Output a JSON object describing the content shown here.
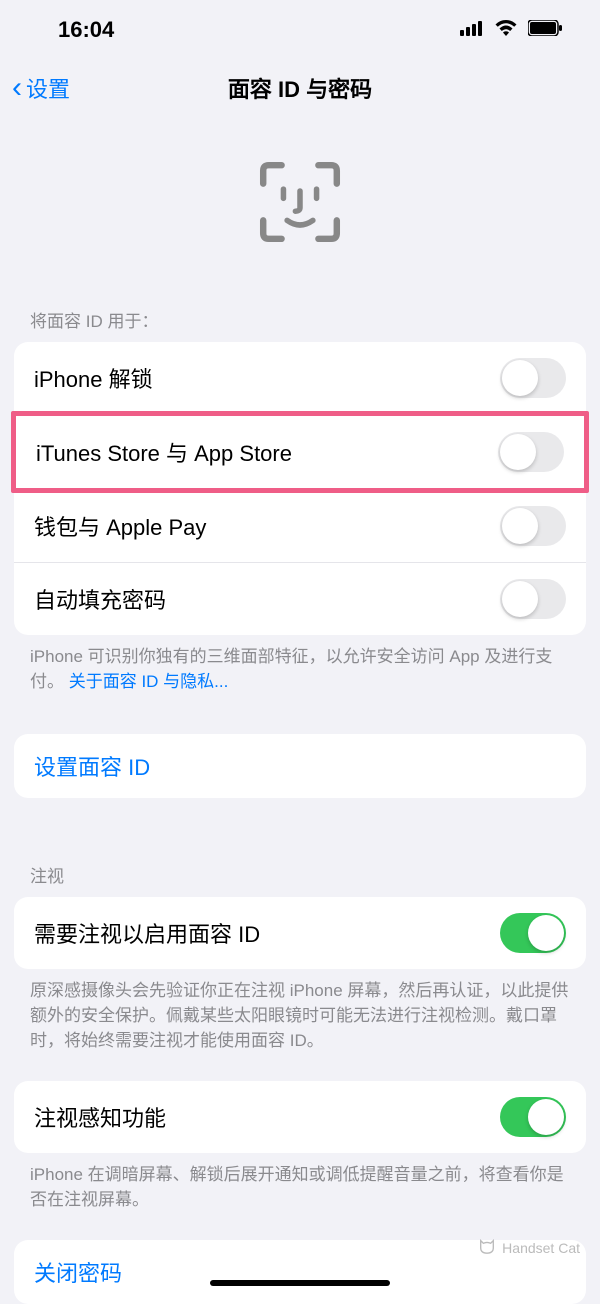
{
  "status": {
    "time": "16:04"
  },
  "nav": {
    "back": "设置",
    "title": "面容 ID 与密码"
  },
  "sections": {
    "useFor": {
      "header": "将面容 ID 用于：",
      "rows": {
        "unlock": "iPhone 解锁",
        "itunes": "iTunes Store 与 App Store",
        "wallet": "钱包与 Apple Pay",
        "autofill": "自动填充密码"
      },
      "footerText": "iPhone 可识别你独有的三维面部特征，以允许安全访问 App 及进行支付。",
      "footerLink": "关于面容 ID 与隐私..."
    },
    "setup": {
      "label": "设置面容 ID"
    },
    "attention": {
      "header": "注视",
      "rows": {
        "require": "需要注视以启用面容 ID",
        "aware": "注视感知功能"
      },
      "footer1": "原深感摄像头会先验证你正在注视 iPhone 屏幕，然后再认证，以此提供额外的安全保护。佩戴某些太阳眼镜时可能无法进行注视检测。戴口罩时，将始终需要注视才能使用面容 ID。",
      "footer2": "iPhone 在调暗屏幕、解锁后展开通知或调低提醒音量之前，将查看你是否在注视屏幕。"
    },
    "passcode": {
      "off": "关闭密码"
    }
  },
  "watermark": "Handset Cat"
}
